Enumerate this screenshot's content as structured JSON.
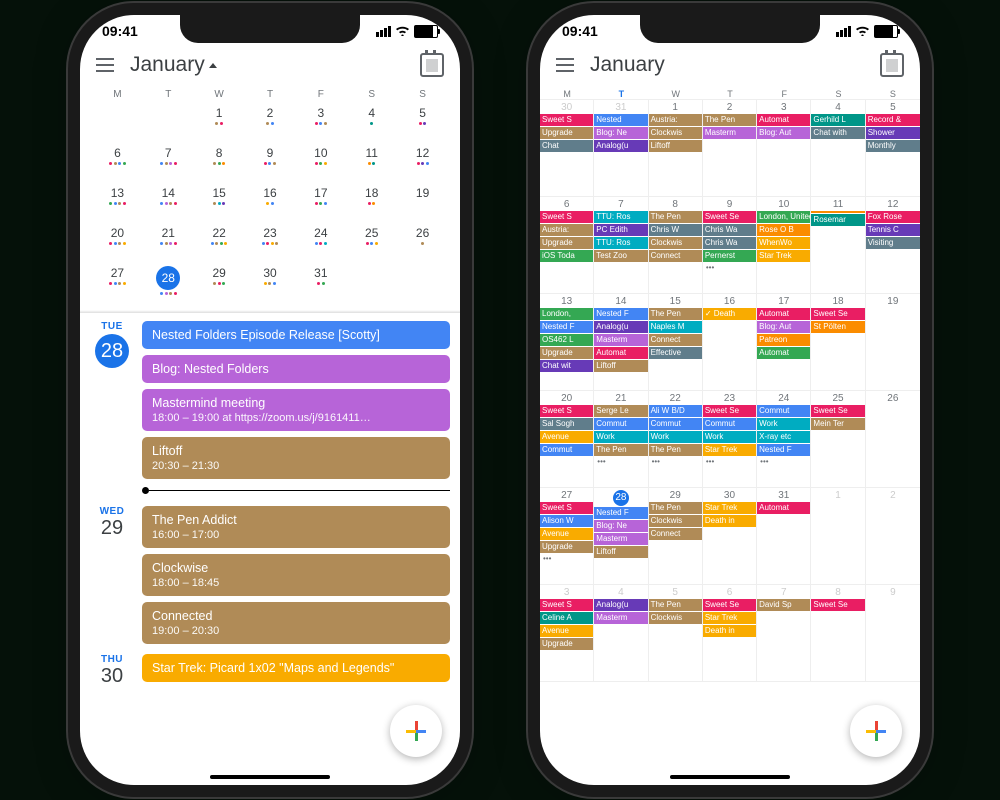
{
  "status_time": "09:41",
  "month_title": "January",
  "dow": [
    "M",
    "T",
    "W",
    "T",
    "F",
    "S",
    "S"
  ],
  "colors": {
    "blue": "#4285f4",
    "pink": "#e91e63",
    "purple": "#b764d8",
    "tan": "#b08b57",
    "green": "#34a853",
    "orange": "#fb8c00",
    "cyan": "#00acc1",
    "teal": "#009688",
    "red": "#ea4335",
    "gold": "#f9ab00",
    "violet": "#673ab7",
    "slate": "#607d8b"
  },
  "mini_month": [
    [
      {
        "n": "",
        "d": []
      },
      {
        "n": "",
        "d": []
      },
      {
        "n": "1",
        "d": [
          "tan",
          "pink"
        ]
      },
      {
        "n": "2",
        "d": [
          "tan",
          "blue"
        ]
      },
      {
        "n": "3",
        "d": [
          "pink",
          "blue",
          "tan"
        ]
      },
      {
        "n": "4",
        "d": [
          "teal"
        ]
      },
      {
        "n": "5",
        "d": [
          "pink",
          "violet"
        ]
      }
    ],
    [
      {
        "n": "6",
        "d": [
          "pink",
          "tan",
          "blue",
          "green"
        ]
      },
      {
        "n": "7",
        "d": [
          "blue",
          "tan",
          "purple",
          "pink"
        ]
      },
      {
        "n": "8",
        "d": [
          "tan",
          "green",
          "orange"
        ]
      },
      {
        "n": "9",
        "d": [
          "pink",
          "blue",
          "tan"
        ]
      },
      {
        "n": "10",
        "d": [
          "pink",
          "green",
          "gold"
        ]
      },
      {
        "n": "11",
        "d": [
          "orange",
          "teal"
        ]
      },
      {
        "n": "12",
        "d": [
          "pink",
          "violet",
          "blue"
        ]
      }
    ],
    [
      {
        "n": "13",
        "d": [
          "green",
          "blue",
          "tan",
          "pink"
        ]
      },
      {
        "n": "14",
        "d": [
          "blue",
          "purple",
          "tan",
          "pink"
        ]
      },
      {
        "n": "15",
        "d": [
          "tan",
          "cyan",
          "violet"
        ]
      },
      {
        "n": "16",
        "d": [
          "gold",
          "blue"
        ]
      },
      {
        "n": "17",
        "d": [
          "pink",
          "green",
          "blue"
        ]
      },
      {
        "n": "18",
        "d": [
          "pink",
          "orange"
        ]
      },
      {
        "n": "19",
        "d": []
      }
    ],
    [
      {
        "n": "20",
        "d": [
          "pink",
          "blue",
          "tan",
          "gold"
        ]
      },
      {
        "n": "21",
        "d": [
          "blue",
          "tan",
          "purple",
          "pink"
        ]
      },
      {
        "n": "22",
        "d": [
          "blue",
          "tan",
          "green",
          "gold"
        ]
      },
      {
        "n": "23",
        "d": [
          "blue",
          "pink",
          "gold",
          "tan"
        ]
      },
      {
        "n": "24",
        "d": [
          "blue",
          "pink",
          "cyan"
        ]
      },
      {
        "n": "25",
        "d": [
          "pink",
          "blue",
          "gold"
        ]
      },
      {
        "n": "26",
        "d": [
          "tan"
        ]
      }
    ],
    [
      {
        "n": "27",
        "d": [
          "pink",
          "blue",
          "tan",
          "gold"
        ]
      },
      {
        "n": "28",
        "sel": true,
        "d": [
          "blue",
          "purple",
          "tan",
          "pink"
        ]
      },
      {
        "n": "29",
        "d": [
          "tan",
          "pink",
          "green"
        ]
      },
      {
        "n": "30",
        "d": [
          "gold",
          "tan",
          "blue"
        ]
      },
      {
        "n": "31",
        "d": [
          "pink",
          "green"
        ]
      },
      {
        "n": "",
        "d": []
      },
      {
        "n": "",
        "d": []
      }
    ]
  ],
  "agenda": [
    {
      "wd": "TUE",
      "dn": "28",
      "today": true,
      "events": [
        {
          "title": "Nested Folders Episode Release [Scotty]",
          "sub": "",
          "c": "blue"
        },
        {
          "title": "Blog: Nested Folders",
          "sub": "",
          "c": "purple"
        },
        {
          "title": "Mastermind meeting",
          "sub": "18:00 – 19:00 at https://zoom.us/j/9161411…",
          "c": "purple"
        },
        {
          "title": "Liftoff",
          "sub": "20:30 – 21:30",
          "c": "tan",
          "nowafter": true
        }
      ]
    },
    {
      "wd": "WED",
      "dn": "29",
      "events": [
        {
          "title": "The Pen Addict",
          "sub": "16:00 – 17:00",
          "c": "tan"
        },
        {
          "title": "Clockwise",
          "sub": "18:00 – 18:45",
          "c": "tan"
        },
        {
          "title": "Connected",
          "sub": "19:00 – 20:30",
          "c": "tan"
        }
      ]
    },
    {
      "wd": "THU",
      "dn": "30",
      "events": [
        {
          "title": "Star Trek: Picard 1x02 \"Maps and Legends\"",
          "sub": "",
          "c": "gold"
        }
      ]
    }
  ],
  "full_month": [
    [
      {
        "n": "30",
        "dim": true,
        "c": [
          [
            "pink",
            "Sweet S"
          ],
          [
            "tan",
            "Upgrade"
          ],
          [
            "slate",
            "Chat"
          ]
        ]
      },
      {
        "n": "31",
        "dim": true,
        "c": [
          [
            "blue",
            "Nested"
          ],
          [
            "purple",
            "Blog: Ne"
          ],
          [
            "violet",
            "Analog(u"
          ]
        ]
      },
      {
        "n": "1",
        "c": [
          [
            "tan",
            "Austria:"
          ],
          [
            "tan",
            "Clockwis"
          ],
          [
            "tan",
            "Liftoff"
          ]
        ]
      },
      {
        "n": "2",
        "c": [
          [
            "tan",
            "The Pen"
          ],
          [
            "purple",
            "Masterm"
          ]
        ]
      },
      {
        "n": "3",
        "c": [
          [
            "pink",
            "Automat"
          ],
          [
            "purple",
            "Blog: Aut"
          ]
        ]
      },
      {
        "n": "4",
        "c": [
          [
            "teal",
            "Gerhild L"
          ],
          [
            "slate",
            "Chat with"
          ]
        ]
      },
      {
        "n": "5",
        "c": [
          [
            "pink",
            "Record &"
          ],
          [
            "violet",
            "Shower"
          ],
          [
            "slate",
            "Monthly"
          ]
        ]
      }
    ],
    [
      {
        "n": "6",
        "c": [
          [
            "pink",
            "Sweet S"
          ],
          [
            "tan",
            "Austria:"
          ],
          [
            "tan",
            "Upgrade"
          ],
          [
            "green",
            "iOS Toda"
          ]
        ]
      },
      {
        "n": "7",
        "c": [
          [
            "cyan",
            "TTU: Ros"
          ],
          [
            "violet",
            "PC Edith"
          ],
          [
            "cyan",
            "TTU: Ros"
          ],
          [
            "tan",
            "Test Zoo"
          ]
        ]
      },
      {
        "n": "8",
        "c": [
          [
            "tan",
            "The Pen"
          ],
          [
            "slate",
            "Chris W"
          ],
          [
            "tan",
            "Clockwis"
          ],
          [
            "tan",
            "Connect"
          ]
        ]
      },
      {
        "n": "9",
        "c": [
          [
            "pink",
            "Sweet Se"
          ],
          [
            "slate",
            "Chris Wa"
          ],
          [
            "slate",
            "Chris Wa"
          ],
          [
            "green",
            "Pernerst"
          ]
        ],
        "more": true
      },
      {
        "n": "10",
        "c": [
          [
            "green",
            "London, United Kingdom, Janu…"
          ],
          [
            "orange",
            "Rose O B"
          ],
          [
            "gold",
            "WhenWo"
          ],
          [
            "gold",
            "Star Trek"
          ]
        ],
        "span": true
      },
      {
        "n": "11",
        "c": [
          [
            "orange",
            ""
          ],
          [
            "teal",
            "Rosemar"
          ]
        ]
      },
      {
        "n": "12",
        "c": [
          [
            "pink",
            "Fox Rose"
          ],
          [
            "violet",
            "Tennis C"
          ],
          [
            "slate",
            "Visiting"
          ]
        ]
      }
    ],
    [
      {
        "n": "13",
        "c": [
          [
            "green",
            "London,"
          ],
          [
            "blue",
            "Nested F"
          ],
          [
            "green",
            "OS462 L"
          ],
          [
            "tan",
            "Upgrade"
          ],
          [
            "violet",
            "Chat wit"
          ]
        ]
      },
      {
        "n": "14",
        "c": [
          [
            "blue",
            "Nested F"
          ],
          [
            "violet",
            "Analog(u"
          ],
          [
            "purple",
            "Masterm"
          ],
          [
            "pink",
            "Automat"
          ],
          [
            "tan",
            "Liftoff"
          ]
        ]
      },
      {
        "n": "15",
        "c": [
          [
            "tan",
            "The Pen"
          ],
          [
            "cyan",
            "Naples M"
          ],
          [
            "tan",
            "Connect"
          ],
          [
            "slate",
            "Effective"
          ]
        ]
      },
      {
        "n": "16",
        "c": [
          [
            "gold",
            "✓ Death"
          ]
        ]
      },
      {
        "n": "17",
        "c": [
          [
            "pink",
            "Automat"
          ],
          [
            "purple",
            "Blog: Aut"
          ],
          [
            "orange",
            "Patreon"
          ],
          [
            "green",
            "Automat"
          ]
        ]
      },
      {
        "n": "18",
        "c": [
          [
            "pink",
            "Sweet Se"
          ],
          [
            "orange",
            "St Pölten"
          ]
        ]
      },
      {
        "n": "19",
        "c": []
      }
    ],
    [
      {
        "n": "20",
        "c": [
          [
            "pink",
            "Sweet S"
          ],
          [
            "slate",
            "Sal Sogh"
          ],
          [
            "gold",
            "Avenue"
          ],
          [
            "blue",
            "Commut"
          ]
        ]
      },
      {
        "n": "21",
        "c": [
          [
            "tan",
            "Serge Le"
          ],
          [
            "blue",
            "Commut"
          ],
          [
            "cyan",
            "Work"
          ],
          [
            "tan",
            "The Pen"
          ]
        ],
        "more": true
      },
      {
        "n": "22",
        "c": [
          [
            "blue",
            "Ali W B/D"
          ],
          [
            "blue",
            "Commut"
          ],
          [
            "cyan",
            "Work"
          ],
          [
            "tan",
            "The Pen"
          ]
        ],
        "more": true
      },
      {
        "n": "23",
        "c": [
          [
            "pink",
            "Sweet Se"
          ],
          [
            "blue",
            "Commut"
          ],
          [
            "cyan",
            "Work"
          ],
          [
            "gold",
            "Star Trek"
          ]
        ],
        "more": true
      },
      {
        "n": "24",
        "c": [
          [
            "blue",
            "Commut"
          ],
          [
            "cyan",
            "Work"
          ],
          [
            "cyan",
            "X-ray etc"
          ],
          [
            "blue",
            "Nested F"
          ]
        ],
        "more": true
      },
      {
        "n": "25",
        "c": [
          [
            "pink",
            "Sweet Se"
          ],
          [
            "tan",
            "Mein Ter"
          ]
        ]
      },
      {
        "n": "26",
        "c": []
      }
    ],
    [
      {
        "n": "27",
        "c": [
          [
            "pink",
            "Sweet S"
          ],
          [
            "blue",
            "Alison W"
          ],
          [
            "gold",
            "Avenue"
          ],
          [
            "tan",
            "Upgrade"
          ]
        ],
        "more": true
      },
      {
        "n": "28",
        "today": true,
        "c": [
          [
            "blue",
            "Nested F"
          ],
          [
            "purple",
            "Blog: Ne"
          ],
          [
            "purple",
            "Masterm"
          ],
          [
            "tan",
            "Liftoff"
          ]
        ]
      },
      {
        "n": "29",
        "c": [
          [
            "tan",
            "The Pen"
          ],
          [
            "tan",
            "Clockwis"
          ],
          [
            "tan",
            "Connect"
          ]
        ]
      },
      {
        "n": "30",
        "c": [
          [
            "gold",
            "Star Trek"
          ],
          [
            "gold",
            "Death in"
          ]
        ]
      },
      {
        "n": "31",
        "c": [
          [
            "pink",
            "Automat"
          ]
        ]
      },
      {
        "n": "1",
        "dim": true,
        "c": []
      },
      {
        "n": "2",
        "dim": true,
        "c": []
      }
    ],
    [
      {
        "n": "3",
        "dim": true,
        "c": [
          [
            "pink",
            "Sweet S"
          ],
          [
            "teal",
            "Celine A"
          ],
          [
            "gold",
            "Avenue"
          ],
          [
            "tan",
            "Upgrade"
          ]
        ]
      },
      {
        "n": "4",
        "dim": true,
        "c": [
          [
            "violet",
            "Analog(u"
          ],
          [
            "purple",
            "Masterm"
          ]
        ]
      },
      {
        "n": "5",
        "dim": true,
        "c": [
          [
            "tan",
            "The Pen"
          ],
          [
            "tan",
            "Clockwis"
          ]
        ]
      },
      {
        "n": "6",
        "dim": true,
        "c": [
          [
            "pink",
            "Sweet Se"
          ],
          [
            "gold",
            "Star Trek"
          ],
          [
            "gold",
            "Death in"
          ]
        ]
      },
      {
        "n": "7",
        "dim": true,
        "c": [
          [
            "tan",
            "David Sp"
          ]
        ]
      },
      {
        "n": "8",
        "dim": true,
        "c": [
          [
            "pink",
            "Sweet Se"
          ]
        ]
      },
      {
        "n": "9",
        "dim": true,
        "c": []
      }
    ]
  ]
}
